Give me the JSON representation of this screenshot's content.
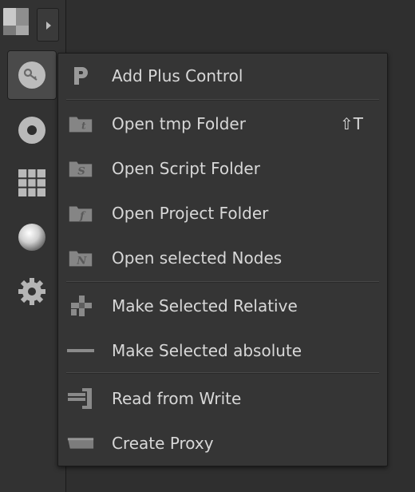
{
  "toolbar": {
    "tools": [
      {
        "name": "key-icon",
        "active": true
      },
      {
        "name": "disc-icon",
        "active": false
      },
      {
        "name": "grid-icon",
        "active": false
      },
      {
        "name": "sphere-icon",
        "active": false
      },
      {
        "name": "gear-icon",
        "active": false
      }
    ]
  },
  "menu": {
    "items": [
      {
        "label": "Add Plus Control",
        "shortcut": "",
        "icon": "p-letter-icon"
      },
      {
        "label": "Open tmp Folder",
        "shortcut": "⇧T",
        "icon": "tmp-folder-icon"
      },
      {
        "label": "Open Script Folder",
        "shortcut": "",
        "icon": "script-folder-icon"
      },
      {
        "label": "Open Project Folder",
        "shortcut": "",
        "icon": "project-folder-icon"
      },
      {
        "label": "Open selected Nodes",
        "shortcut": "",
        "icon": "nodes-folder-icon"
      },
      {
        "label": "Make Selected Relative",
        "shortcut": "",
        "icon": "relative-icon"
      },
      {
        "label": "Make Selected absolute",
        "shortcut": "",
        "icon": "absolute-dash-icon"
      },
      {
        "label": "Read from Write",
        "shortcut": "",
        "icon": "read-from-write-icon"
      },
      {
        "label": "Create Proxy",
        "shortcut": "",
        "icon": "proxy-icon"
      }
    ]
  }
}
